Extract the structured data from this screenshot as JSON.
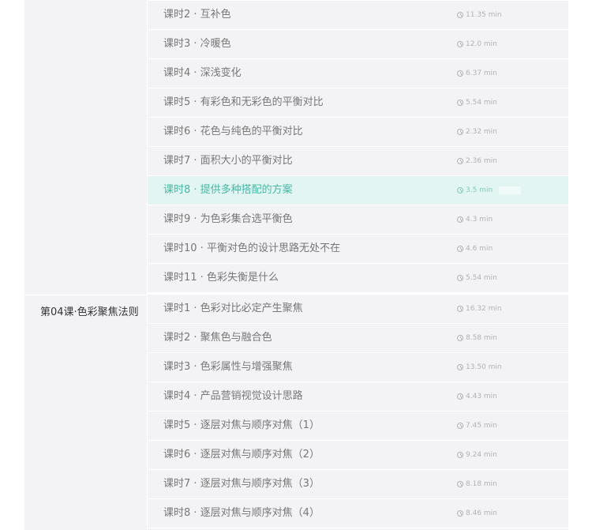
{
  "accent_color": "#44b9a4",
  "chapter": {
    "title": "第04课·色彩聚焦法则"
  },
  "group_a": {
    "lessons": [
      {
        "title": "课时2 · 互补色",
        "duration": "11.35 min"
      },
      {
        "title": "课时3 · 冷暖色",
        "duration": "12.0 min"
      },
      {
        "title": "课时4 · 深浅变化",
        "duration": "6.37 min"
      },
      {
        "title": "课时5 · 有彩色和无彩色的平衡对比",
        "duration": "5.54 min"
      },
      {
        "title": "课时6 · 花色与纯色的平衡对比",
        "duration": "2.32 min"
      },
      {
        "title": "课时7 · 面积大小的平衡对比",
        "duration": "2.36 min"
      },
      {
        "title": "课时8 · 提供多种搭配的方案",
        "duration": "3.5 min",
        "active": true
      },
      {
        "title": "课时9 · 为色彩集合选平衡色",
        "duration": "4.3 min"
      },
      {
        "title": "课时10 · 平衡对色的设计思路无处不在",
        "duration": "4.6 min"
      },
      {
        "title": "课时11 · 色彩失衡是什么",
        "duration": "5.54 min"
      }
    ]
  },
  "group_b": {
    "lessons": [
      {
        "title": "课时1 · 色彩对比必定产生聚焦",
        "duration": "16.32 min"
      },
      {
        "title": "课时2 · 聚焦色与融合色",
        "duration": "8.58 min"
      },
      {
        "title": "课时3 · 色彩属性与增强聚焦",
        "duration": "13.50 min"
      },
      {
        "title": "课时4 · 产品营销视觉设计思路",
        "duration": "4.43 min"
      },
      {
        "title": "课时5 · 逐层对焦与顺序对焦（1）",
        "duration": "7.45 min"
      },
      {
        "title": "课时6 · 逐层对焦与顺序对焦（2）",
        "duration": "9.24 min"
      },
      {
        "title": "课时7 · 逐层对焦与顺序对焦（3）",
        "duration": "8.18 min"
      },
      {
        "title": "课时8 · 逐层对焦与顺序对焦（4）",
        "duration": "8.46 min"
      }
    ]
  }
}
